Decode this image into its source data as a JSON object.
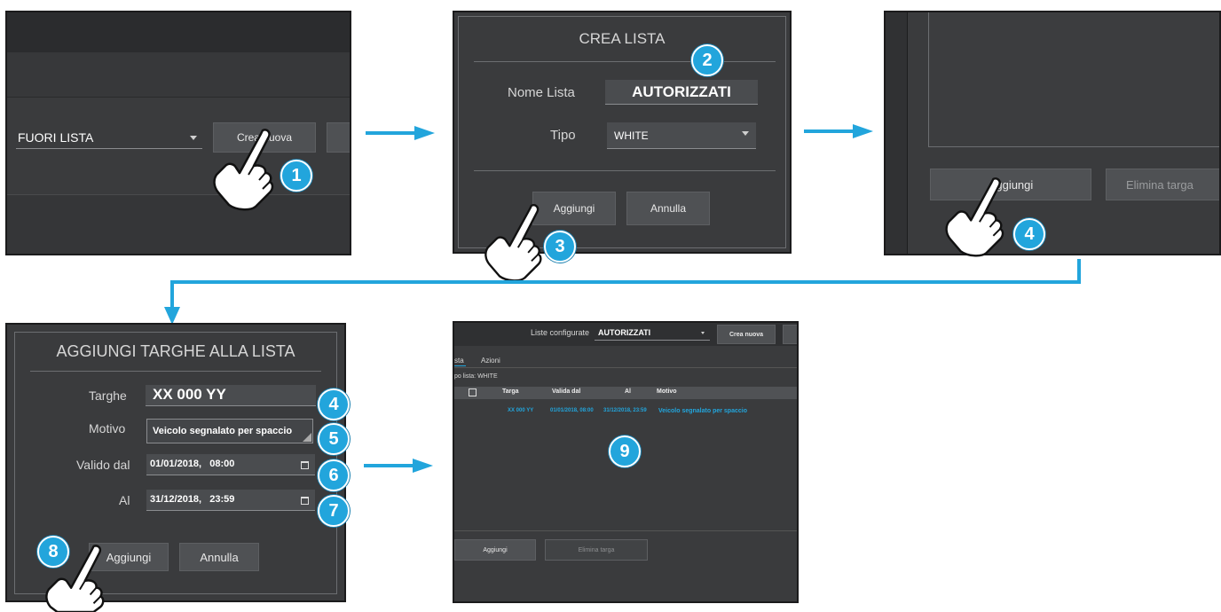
{
  "panel1": {
    "select_value": "FUORI LISTA",
    "create_button": "Crea nuova",
    "badge": "1"
  },
  "panel2": {
    "title": "CREA LISTA",
    "name_label": "Nome Lista",
    "name_value": "AUTORIZZATI",
    "type_label": "Tipo",
    "type_value": "WHITE",
    "add_button": "Aggiungi",
    "cancel_button": "Annulla",
    "badge_name": "2",
    "badge_add": "3"
  },
  "panel3": {
    "add_button": "Aggiungi",
    "delete_button": "Elimina targa",
    "badge": "4"
  },
  "panel4": {
    "title": "AGGIUNGI TARGHE ALLA LISTA",
    "plates_label": "Targhe",
    "plates_value": "XX 000 YY",
    "reason_label": "Motivo",
    "reason_value": "Veicolo segnalato per spaccio",
    "from_label": "Valido dal",
    "from_value": "01/01/2018,   08:00",
    "to_label": "Al",
    "to_value": "31/12/2018,   23:59",
    "add_button": "Aggiungi",
    "cancel_button": "Annulla",
    "badges": [
      "4",
      "5",
      "6",
      "7",
      "8"
    ]
  },
  "panel5": {
    "lists_label": "Liste configurate",
    "lists_value": "AUTORIZZATI",
    "create_button": "Crea nuova",
    "tab_list": "sta",
    "tab_actions": "Azioni",
    "list_type": "po lista: WHITE",
    "columns": [
      "Targa",
      "Valida dal",
      "Al",
      "Motivo"
    ],
    "row": {
      "plate": "XX 000 YY",
      "from": "01/01/2018, 08:00",
      "to": "31/12/2018, 23:59",
      "reason": "Veicolo segnalato per spaccio"
    },
    "add_button": "Aggiungi",
    "delete_button": "Elimina targa",
    "badge": "9"
  },
  "colors": {
    "accent": "#22a5dc",
    "panel_bg": "#3a3b3d",
    "header_bg": "#2b2c2e"
  }
}
